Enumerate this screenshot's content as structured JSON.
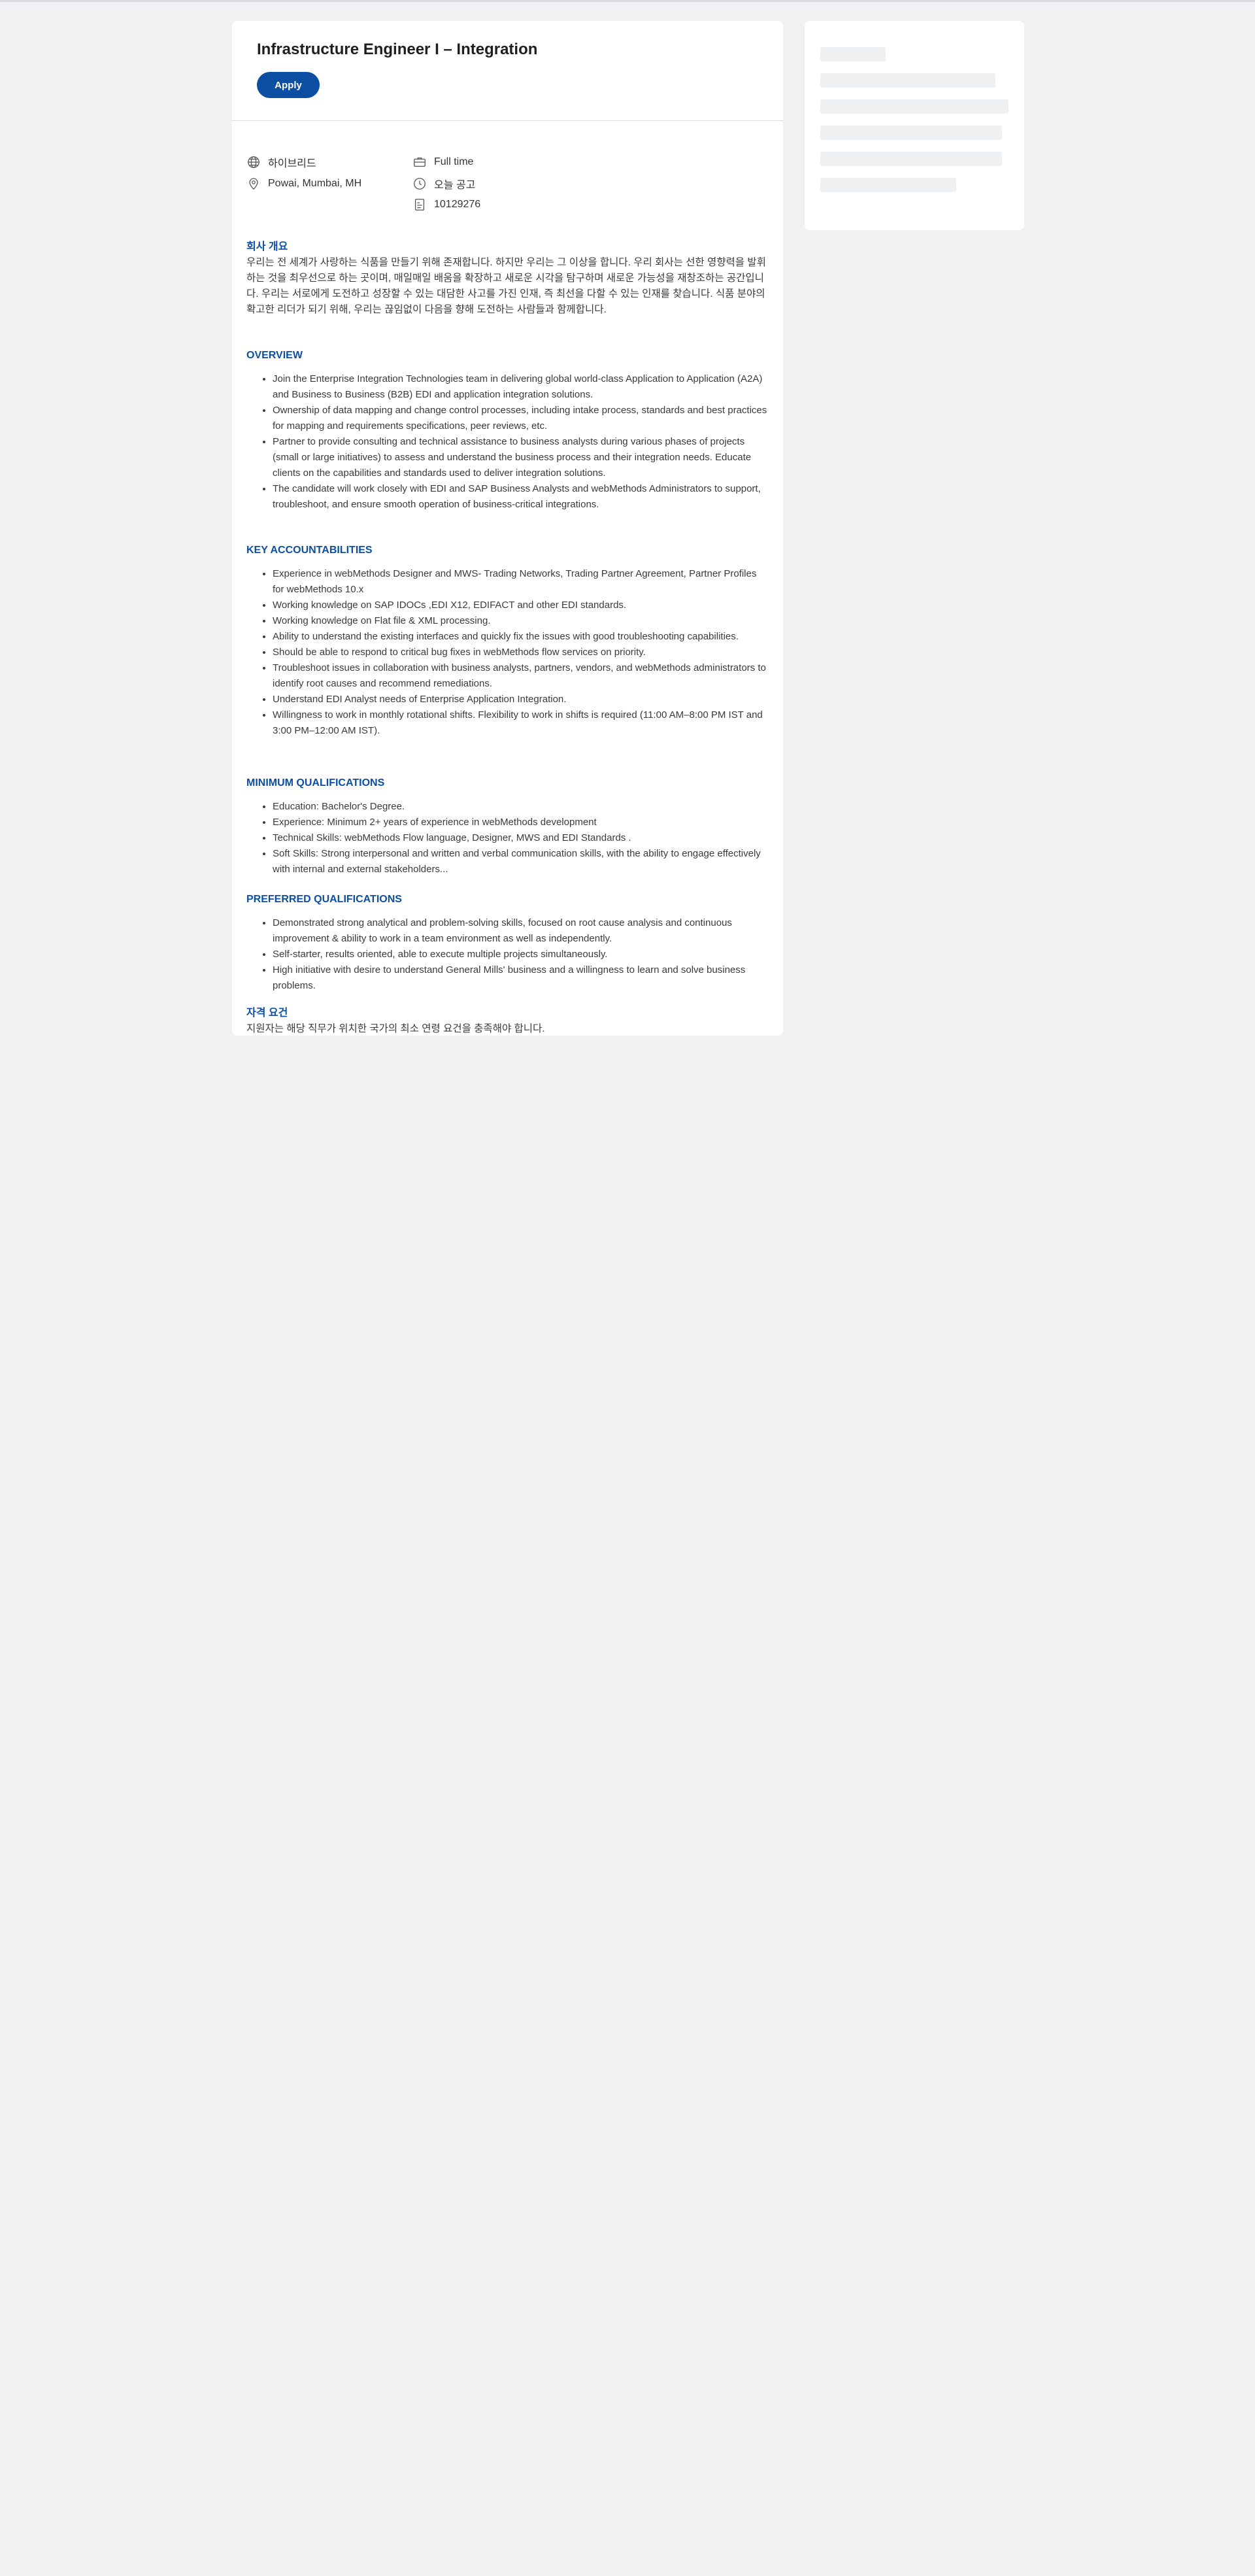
{
  "job": {
    "title": "Infrastructure Engineer I – Integration",
    "apply_label": "Apply"
  },
  "meta": {
    "work_type": "하이브리드",
    "location": "Powai, Mumbai, MH",
    "employment": "Full time",
    "posted": "오늘 공고",
    "job_id": "10129276"
  },
  "about": {
    "title": "회사 개요",
    "text": "우리는 전 세계가 사랑하는 식품을 만들기 위해 존재합니다. 하지만 우리는 그 이상을 합니다. 우리 회사는 선한 영향력을 발휘하는 것을 최우선으로 하는 곳이며, 매일매일 배움을 확장하고 새로운 시각을 탐구하며 새로운 가능성을 재창조하는 공간입니다. 우리는 서로에게 도전하고 성장할 수 있는 대담한 사고를 가진 인재, 즉 최선을 다할 수 있는 인재를 찾습니다. 식품 분야의 확고한 리더가 되기 위해, 우리는 끊임없이 다음을 향해 도전하는 사람들과 함께합니다."
  },
  "overview": {
    "title": "OVERVIEW",
    "items": [
      "Join the Enterprise Integration Technologies team in delivering global world-class Application to Application (A2A) and Business to Business (B2B) EDI and application integration solutions.",
      "Ownership of data mapping and change control processes, including intake process, standards and best practices for mapping and requirements specifications, peer reviews, etc.",
      "Partner to provide consulting and technical assistance to business analysts during various phases of projects (small or large initiatives) to assess and understand the business process and their integration needs.  Educate clients on the capabilities and standards used to deliver integration solutions.",
      "The candidate will work closely with EDI and SAP Business Analysts and webMethods Administrators to support, troubleshoot, and ensure smooth operation of business-critical integrations."
    ]
  },
  "accountabilities": {
    "title": "KEY ACCOUNTABILITIES",
    "items": [
      "Experience in webMethods Designer and MWS- Trading Networks, Trading Partner Agreement, Partner Profiles for webMethods 10.x",
      "Working knowledge on SAP IDOCs ,EDI X12, EDIFACT and other EDI standards.",
      "Working knowledge on Flat file &  XML processing.",
      "Ability to understand the existing interfaces and quickly fix the issues with good troubleshooting capabilities.",
      "Should be able to respond to critical bug fixes in webMethods flow services on priority.",
      "Troubleshoot issues in collaboration with business analysts, partners, vendors, and webMethods administrators to identify root causes and recommend remediations.",
      "Understand EDI Analyst needs of Enterprise Application Integration.",
      "Willingness to work in monthly rotational shifts. Flexibility to work in shifts is required (11:00 AM–8:00 PM IST and 3:00 PM–12:00 AM IST)."
    ]
  },
  "min_quals": {
    "title": "MINIMUM QUALIFICATIONS",
    "items": [
      "Education: Bachelor's Degree.",
      "Experience: Minimum 2+ years of experience in webMethods development",
      "Technical Skills: webMethods Flow language, Designer, MWS and EDI Standards .",
      "Soft Skills: Strong interpersonal and written and verbal communication skills, with the ability to engage effectively with internal and external stakeholders..."
    ]
  },
  "pref_quals": {
    "title": "PREFERRED QUALIFICATIONS",
    "items": [
      "Demonstrated strong analytical and problem-solving skills, focused on root cause analysis and continuous improvement & ability to work in a team environment as well as independently.",
      "Self-starter, results oriented, able to execute multiple projects simultaneously.",
      "High initiative with desire to understand General Mills' business and a willingness to learn and solve business problems."
    ]
  },
  "eligibility": {
    "title": "자격 요건",
    "text": "지원자는 해당 직무가 위치한 국가의 최소 연령 요건을 충족해야 합니다."
  }
}
